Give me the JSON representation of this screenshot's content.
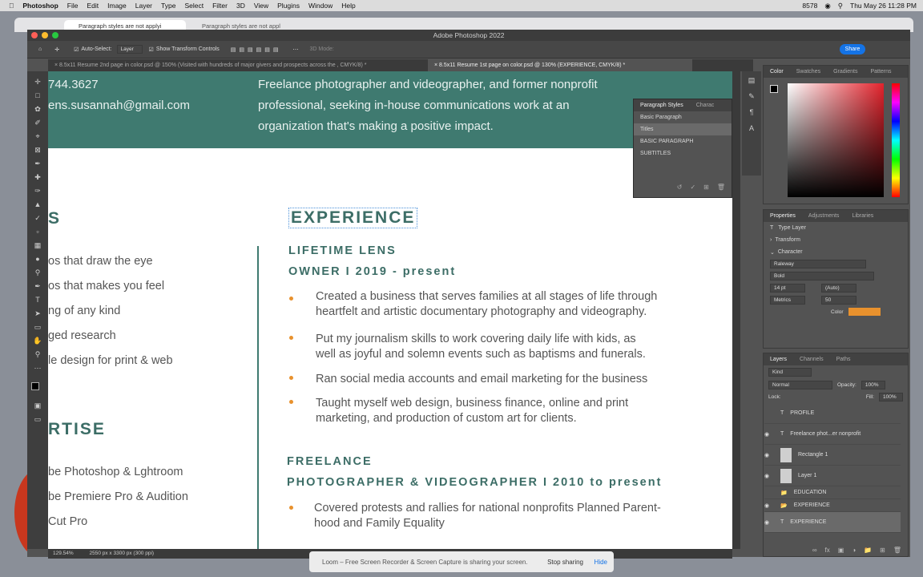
{
  "mac_menu": {
    "app": "Photoshop",
    "items": [
      "File",
      "Edit",
      "Image",
      "Layer",
      "Type",
      "Select",
      "Filter",
      "3D",
      "View",
      "Plugins",
      "Window",
      "Help"
    ],
    "battery": "8578",
    "clock": "Thu May 26  11:28 PM"
  },
  "browser_tabs": [
    "Paragraph styles are not applyi",
    "Paragraph styles are not appl"
  ],
  "app_title": "Adobe Photoshop 2022",
  "options_bar": {
    "auto_select_label": "Auto-Select:",
    "auto_select_value": "Layer",
    "show_transform": "Show Transform Controls",
    "mode": "3D Mode:",
    "share": "Share"
  },
  "doc_tabs": [
    "× 8.5x11 Resume 2nd page in color.psd @ 150% (Visited with hundreds of major givers and prospects across the , CMYK/8) *",
    "× 8.5x11 Resume 1st page on color.psd @ 130% (EXPERIENCE, CMYK/8) *"
  ],
  "resume": {
    "phone": "744.3627",
    "email": "ens.susannah@gmail.com",
    "intro": [
      "Freelance photographer and videographer, and former nonprofit",
      "professional, seeking in-house communications work at an",
      "organization that's making a positive impact."
    ],
    "left_heading1": "S",
    "left_items1": [
      "os that draw the eye",
      "os that makes you feel",
      "ng of any kind",
      "ged research",
      "le design for print & web"
    ],
    "left_heading2": "RTISE",
    "left_items2": [
      "be Photoshop & Lghtroom",
      "be Premiere Pro & Audition",
      "Cut Pro"
    ],
    "experience_heading": "EXPERIENCE",
    "job1_company": "LIFETIME LENS",
    "job1_title": "OWNER  I  2019 - present",
    "job1_bullets": [
      [
        "Created a business that serves families at all stages of life through",
        "heartfelt and artistic documentary photography and videography."
      ],
      [
        "Put my journalism skills to work covering daily life with kids, as",
        "well as joyful and solemn events such as baptisms and funerals."
      ],
      [
        "Ran social media accounts and email marketing for the business"
      ],
      [
        "Taught myself web design, business finance, online and print",
        "marketing, and production of custom art for clients."
      ]
    ],
    "job2_company": "FREELANCE",
    "job2_title": "PHOTOGRAPHER & VIDEOGRAPHER  I  2010 to present",
    "job2_bullets": [
      [
        "Covered protests and rallies for national nonprofits Planned Parent-",
        "hood and Family Equality"
      ]
    ]
  },
  "para_styles": {
    "tabs": [
      "Paragraph Styles",
      "Charac"
    ],
    "items": [
      "Basic Paragraph",
      "Titles",
      "BASIC PARAGRAPH",
      "SUBTITLES"
    ]
  },
  "color_panel": {
    "tabs": [
      "Color",
      "Swatches",
      "Gradients",
      "Patterns"
    ]
  },
  "properties": {
    "tabs": [
      "Properties",
      "Adjustments",
      "Libraries"
    ],
    "type_layer": "Type Layer",
    "transform": "Transform",
    "character": "Character",
    "font": "Raleway",
    "style": "Bold",
    "size": "14 pt",
    "leading": "(Auto)",
    "kerning": "Metrics",
    "tracking": "50",
    "color_label": "Color",
    "color": "#e8912d"
  },
  "layers": {
    "tabs": [
      "Layers",
      "Channels",
      "Paths"
    ],
    "kind": "Kind",
    "blend": "Normal",
    "opacity_label": "Opacity:",
    "opacity": "100%",
    "lock_label": "Lock:",
    "fill_label": "Fill:",
    "fill": "100%",
    "items": [
      "PROFILE",
      "Freelance phot...er nonprofit",
      "Rectangle 1",
      "Layer 1",
      "EDUCATION",
      "EXPERIENCE",
      "EXPERIENCE"
    ]
  },
  "status": {
    "zoom": "129.54%",
    "size": "2550 px x 3300 px (300 ppi)"
  },
  "loom": {
    "message": "Loom – Free Screen Recorder & Screen Capture is sharing your screen.",
    "stop": "Stop sharing",
    "hide": "Hide"
  }
}
